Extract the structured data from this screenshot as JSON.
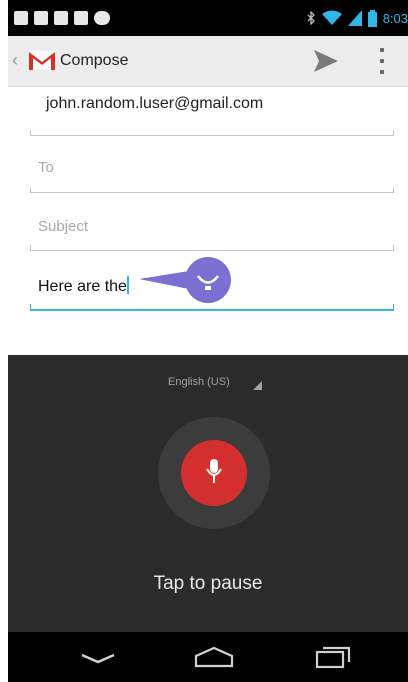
{
  "status_bar": {
    "time": "8:03"
  },
  "action_bar": {
    "title": "Compose"
  },
  "compose": {
    "from": "john.random.luser@gmail.com",
    "to_placeholder": "To",
    "subject_placeholder": "Subject",
    "body": "Here are the"
  },
  "voice_input": {
    "language": "English (US)",
    "status": "Tap to pause"
  },
  "colors": {
    "accent": "#33b5e5",
    "mic": "#d32f2f",
    "bubble": "#7b6fd1",
    "panel": "#2b2b2b"
  },
  "icons": [
    "back-nav-icon",
    "home-nav-icon",
    "recent-apps-icon",
    "microphone-icon",
    "send-icon",
    "overflow-menu-icon",
    "gmail-logo",
    "wifi-icon",
    "signal-icon",
    "battery-icon"
  ]
}
